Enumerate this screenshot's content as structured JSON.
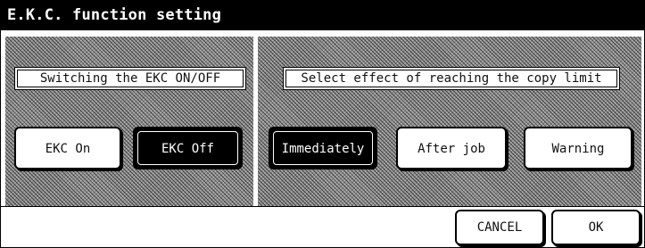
{
  "window": {
    "title": "E.K.C. function setting"
  },
  "ekc_section": {
    "label": "Switching the EKC ON/OFF",
    "buttons": [
      {
        "label": "EKC On",
        "selected": false
      },
      {
        "label": "EKC Off",
        "selected": true
      }
    ]
  },
  "limit_section": {
    "label": "Select effect of reaching the copy limit",
    "buttons": [
      {
        "label": "Immediately",
        "selected": true
      },
      {
        "label": "After job",
        "selected": false
      },
      {
        "label": "Warning",
        "selected": false
      }
    ]
  },
  "footer": {
    "cancel_label": "CANCEL",
    "ok_label": "OK"
  },
  "colors": {
    "background": "#ffffff",
    "foreground": "#000000",
    "hatch": "#8f8f8f"
  }
}
